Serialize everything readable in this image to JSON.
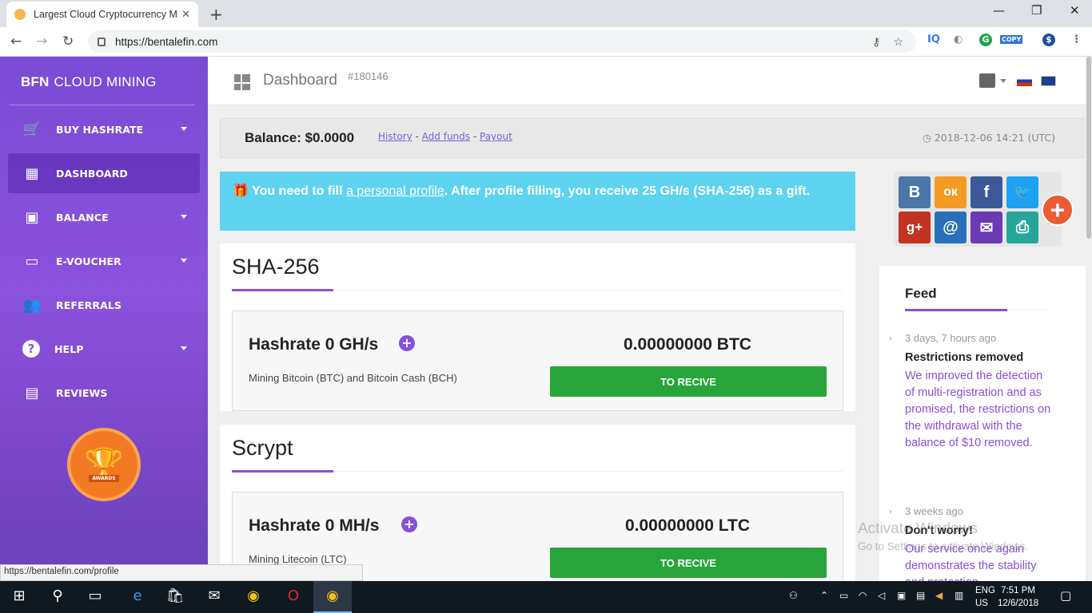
{
  "browser": {
    "tab_title": "Largest Cloud Cryptocurrency Mi",
    "tab_close": "✕",
    "new_tab": "+",
    "url": "https://bentalefin.com",
    "status_url": "https://bentalefin.com/profile",
    "ext_iq": "IQ",
    "ext_copy": "COPY"
  },
  "sidebar": {
    "brand_bold": "BFN",
    "brand_rest": "CLOUD MINING",
    "items": [
      {
        "label": "BUY HASHRATE",
        "icon": "cart-icon",
        "caret": true
      },
      {
        "label": "DASHBOARD",
        "icon": "dashboard-icon",
        "caret": false,
        "active": true
      },
      {
        "label": "BALANCE",
        "icon": "wallet-icon",
        "caret": true
      },
      {
        "label": "E-VOUCHER",
        "icon": "card-icon",
        "caret": true
      },
      {
        "label": "REFERRALS",
        "icon": "people-icon",
        "caret": false
      },
      {
        "label": "HELP",
        "icon": "help-icon",
        "caret": true
      },
      {
        "label": "REVIEWS",
        "icon": "chat-icon",
        "caret": false
      }
    ],
    "award_label": "AWARDS"
  },
  "header": {
    "title": "Dashboard",
    "account_id": "#180146"
  },
  "balance": {
    "label": "Balance: $0.0000",
    "history": "History",
    "sep1": " - ",
    "add_funds": "Add funds",
    "sep2": " - ",
    "payout": "Payout",
    "datetime": "2018-12-06 14:21 (UTC)"
  },
  "alert": {
    "prefix": "You need to fill ",
    "link": "a personal profile",
    "suffix": ". After profile filling, you receive 25 GH/s (SHA-256) as a gift."
  },
  "algorithms": [
    {
      "title": "SHA-256",
      "hashrate": "Hashrate 0 GH/s",
      "sub": "Mining Bitcoin (BTC) and Bitcoin Cash (BCH)",
      "amount": "0.00000000 BTC",
      "button": "TO RECIVE"
    },
    {
      "title": "Scrypt",
      "hashrate": "Hashrate 0 MH/s",
      "sub": "Mining Litecoin (LTC)",
      "amount": "0.00000000 LTC",
      "button": "TO RECIVE"
    }
  ],
  "share": {
    "buttons": [
      {
        "label": "B",
        "name": "vk-share-button",
        "color": "#4a76a8"
      },
      {
        "label": "ок",
        "name": "ok-share-button",
        "color": "#f59a22"
      },
      {
        "label": "f",
        "name": "facebook-share-button",
        "color": "#3b5998"
      },
      {
        "label": "🐦",
        "name": "twitter-share-button",
        "color": "#1da1f2"
      },
      {
        "label": "g+",
        "name": "googleplus-share-button",
        "color": "#c23321"
      },
      {
        "label": "@",
        "name": "mail-share-button",
        "color": "#2a70b8"
      },
      {
        "label": "✉",
        "name": "email-share-button",
        "color": "#6a3ab2"
      },
      {
        "label": "⎙",
        "name": "print-share-button",
        "color": "#26a69a"
      }
    ],
    "more": "+"
  },
  "feed": {
    "title": "Feed",
    "items": [
      {
        "date": "3 days, 7 hours ago",
        "heading": "Restrictions removed",
        "body": "We improved the detection of multi-registration and as promised, the restrictions on the withdrawal with the balance of $10 removed."
      },
      {
        "date": "3 weeks ago",
        "heading": "Don't worry!",
        "body": "Our service once again demonstrates the stability and protection"
      }
    ]
  },
  "watermark": {
    "line1": "Activate Windows",
    "line2": "Go to Settings to activate Windows."
  },
  "taskbar": {
    "lang1": "ENG",
    "lang2": "US",
    "time": "7:51 PM",
    "date": "12/6/2018"
  },
  "colors": {
    "accent": "#8a4fd8",
    "green": "#27a53a",
    "alert": "#5dd3f0"
  }
}
